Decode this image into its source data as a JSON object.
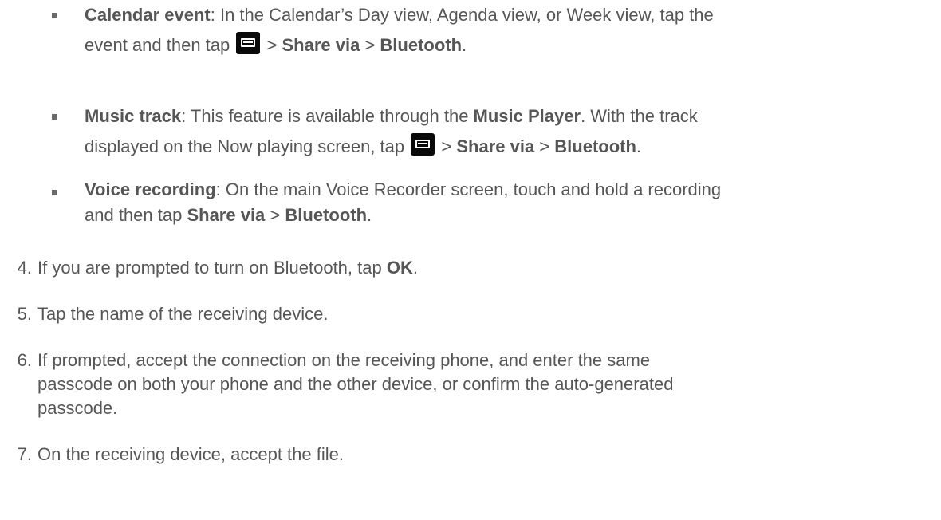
{
  "bullets": [
    {
      "title": "Calendar event",
      "sep": ": ",
      "text1": "In the Calendar’s Day view, Agenda view, or Week view, tap the",
      "text2": "event and then tap",
      "gt1": " > ",
      "share": "Share via",
      "gt2": " > ",
      "bt": "Bluetooth",
      "end": ".",
      "icon": "menu-icon"
    },
    {
      "title": "Music track",
      "sep": ": ",
      "text1": "This feature is available through the ",
      "bold1": "Music Player",
      "text1b": ". With the track",
      "text2": "displayed on the Now playing screen, tap",
      "gt1": " > ",
      "share": "Share via",
      "gt2": " > ",
      "bt": "Bluetooth",
      "end": ".",
      "icon": "menu-icon"
    },
    {
      "title": "Voice recording",
      "sep": ": ",
      "text1": "On the main Voice Recorder screen, touch and hold a recording",
      "text2": "and then tap ",
      "share": "Share via",
      "gt2": " > ",
      "bt": "Bluetooth",
      "end": "."
    }
  ],
  "steps": [
    {
      "num": "4.",
      "text": "If you are prompted to turn on Bluetooth, tap ",
      "bold": "OK",
      "end": "."
    },
    {
      "num": "5.",
      "text": "Tap the name of the receiving device."
    },
    {
      "num": "6.",
      "line1": "If prompted, accept the connection on the receiving phone, and enter the same",
      "line2": "passcode on both your phone and the other device, or confirm the auto-generated",
      "line3": "passcode."
    },
    {
      "num": "7.",
      "text": "On the receiving device, accept the file."
    }
  ]
}
